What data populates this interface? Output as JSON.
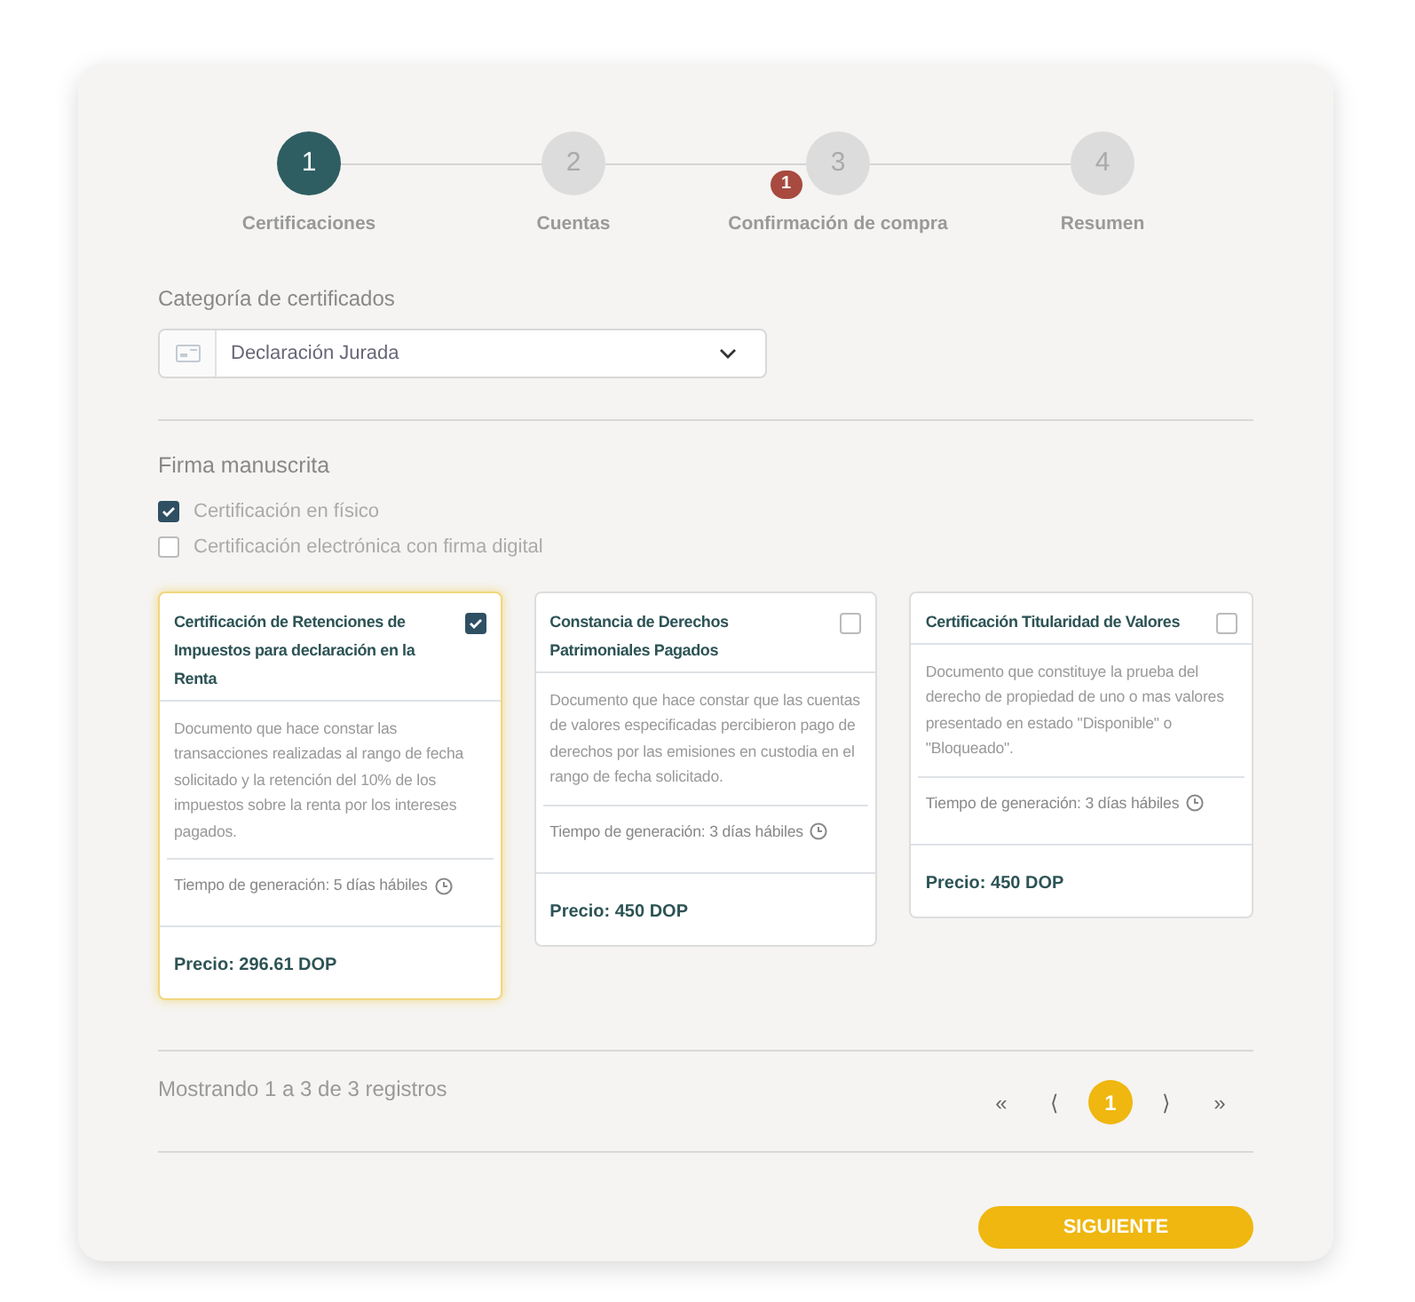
{
  "steps": [
    {
      "number": "1",
      "label": "Certificaciones",
      "selected": true
    },
    {
      "number": "2",
      "label": "Cuentas",
      "selected": false
    },
    {
      "number": "3",
      "label": "Confirmación de compra",
      "selected": false,
      "badge": "1"
    },
    {
      "number": "4",
      "label": "Resumen",
      "selected": false
    }
  ],
  "category": {
    "label": "Categoría de certificados",
    "value": "Declaración Jurada"
  },
  "signature": {
    "title": "Firma manuscrita",
    "options": [
      {
        "label": "Certificación en físico",
        "checked": true
      },
      {
        "label": "Certificación electrónica con firma digital",
        "checked": false
      }
    ]
  },
  "certificates": [
    {
      "title": "Certificación de Retenciones de Impuestos para declaración en la Renta",
      "selected": true,
      "description": "Documento que hace constar las transacciones realizadas al rango de fecha solicitado y la retención del 10% de los impuestos sobre la renta por los intereses pagados.",
      "time": "Tiempo de generación: 5 días hábiles",
      "price": "Precio: 296.61 DOP"
    },
    {
      "title": "Constancia de Derechos Patrimoniales Pagados",
      "selected": false,
      "description": "Documento que hace constar que las cuentas de valores especificadas percibieron pago de derechos por las emisiones en custodia en el rango de fecha solicitado.",
      "time": "Tiempo de generación: 3 días hábiles",
      "price": "Precio: 450 DOP"
    },
    {
      "title": "Certificación Titularidad de Valores",
      "selected": false,
      "description": "Documento que constituye la prueba del derecho de propiedad de uno o mas valores presentado en estado \"Disponible\" o \"Bloqueado\".",
      "time": "Tiempo de generación: 3 días hábiles",
      "price": "Precio: 450 DOP"
    }
  ],
  "pagination": {
    "summary": "Mostrando 1 a 3 de 3 registros",
    "first": "«",
    "prev": "⟨",
    "pages": [
      {
        "label": "1",
        "selected": true
      }
    ],
    "next": "⟩",
    "last": "»"
  },
  "next_button": "SIGUIENTE"
}
